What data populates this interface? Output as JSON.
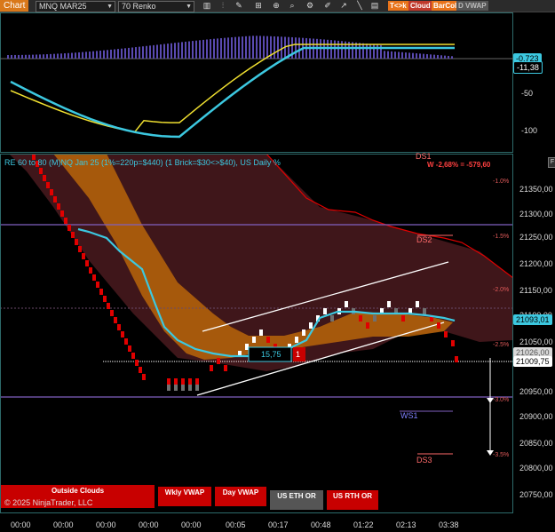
{
  "toolbar": {
    "chart_tab": "Chart",
    "instrument": "MNQ MAR25",
    "bar_type": "70 Renko",
    "buttons": [
      {
        "label": "T<>k",
        "color": "#e8731a"
      },
      {
        "label": "Cloud",
        "color": "#c0392b"
      },
      {
        "label": "BarCol",
        "color": "#e8731a"
      },
      {
        "label": "D VWAP",
        "color": "#555555"
      }
    ]
  },
  "top_panel": {
    "axis_labels": [
      "-50",
      "-100"
    ],
    "tag_value_1": "-0,723",
    "tag_value_2": "-11,38"
  },
  "main_panel": {
    "info_text": "RE 60 to 80 (M)NQ Jan 25 (1%=220p=$440) (1 Brick=$30<>$40), US Daily %",
    "week_text": "W -2,68% = -579,60",
    "price_axis": [
      "21350,00",
      "21300,00",
      "21250,00",
      "21200,00",
      "21150,00",
      "21100,00",
      "21050,00",
      "20950,00",
      "20900,00",
      "20850,00",
      "20800,00",
      "20750,00"
    ],
    "price_tag_current": "21093,01",
    "price_tag_mid": "21026,00",
    "price_tag_last": "21009,75",
    "box_value": "15,75",
    "box_count": "1",
    "pct_labels": [
      "-1.0%",
      "-1.5%",
      "-2.0%",
      "-2.5%",
      "-3.0%",
      "-3.5%"
    ],
    "levels": {
      "ds1": "DS1",
      "ds2": "DS2",
      "ws1": "WS1",
      "ds3": "DS3"
    },
    "copyright": "© 2025 NinjaTrader, LLC",
    "bottom_buttons": [
      {
        "label": "Outside Clouds",
        "color": "#c80000"
      },
      {
        "label": "Wkly VWAP",
        "color": "#c80000"
      },
      {
        "label": "Day VWAP",
        "color": "#c80000"
      },
      {
        "label": "US ETH OR",
        "color": "#555555"
      },
      {
        "label": "US RTH OR",
        "color": "#c80000"
      }
    ],
    "time_axis": [
      "00:00",
      "00:00",
      "00:00",
      "00:00",
      "00:00",
      "00:05",
      "00:17",
      "00:48",
      "01:22",
      "02:13",
      "03:38"
    ]
  },
  "colors": {
    "accent_cyan": "#3cc8e0",
    "yellow": "#f0e030",
    "bear_red": "#e00000",
    "bull_white": "#ffffff",
    "cloud_orange": "#b8650a",
    "cloud_dark": "#4a1a1e",
    "axis_bg": "#000000",
    "purple": "#8060c0"
  }
}
